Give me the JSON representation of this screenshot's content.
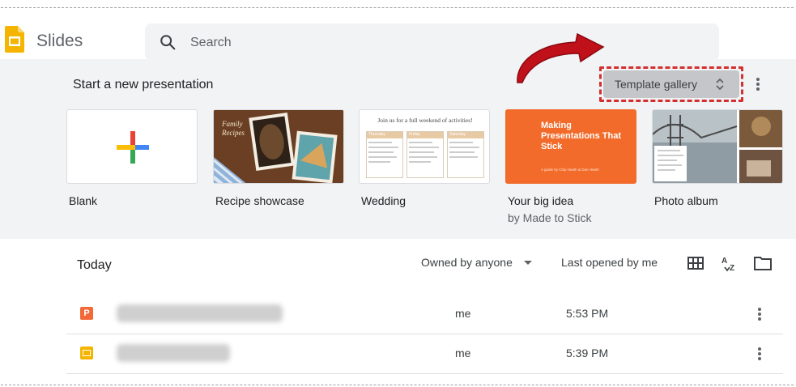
{
  "header": {
    "app_title": "Slides",
    "logo_icon": "google-slides-logo-icon",
    "search": {
      "placeholder": "Search",
      "icon": "search-icon"
    }
  },
  "templates": {
    "section_label": "Start a new presentation",
    "gallery_button": {
      "label": "Template gallery",
      "icon": "unfold-icon"
    },
    "more_icon": "more-vert-icon",
    "items": [
      {
        "name": "Blank",
        "subtitle": ""
      },
      {
        "name": "Recipe showcase",
        "subtitle": "",
        "thumb_title": "Family Recipes"
      },
      {
        "name": "Wedding",
        "subtitle": "",
        "thumb_title": "Join us for a full weekend of activities!",
        "thumb_cols": [
          "Thursday",
          "Friday",
          "Saturday"
        ]
      },
      {
        "name": "Your big idea",
        "subtitle": "by Made to Stick",
        "thumb_title": "Making Presentations That Stick",
        "thumb_byline": "A guide by Chip Heath & Dan Heath"
      },
      {
        "name": "Photo album",
        "subtitle": ""
      }
    ]
  },
  "recent": {
    "section_label": "Today",
    "owner_filter": "Owned by anyone",
    "sort_label": "Last opened by me",
    "tools": [
      "grid-view-icon",
      "sort-az-icon",
      "folder-icon"
    ],
    "files": [
      {
        "type": "powerpoint",
        "owner": "me",
        "time": "5:53 PM",
        "icon_color": "#f26937"
      },
      {
        "type": "slides",
        "owner": "me",
        "time": "5:39 PM",
        "icon_color": "#f4b400"
      }
    ]
  },
  "colors": {
    "slides_yellow": "#f4b400",
    "highlight_red": "#d32f2f",
    "arrow_red": "#c0101a",
    "band_gray": "#f1f3f4"
  }
}
